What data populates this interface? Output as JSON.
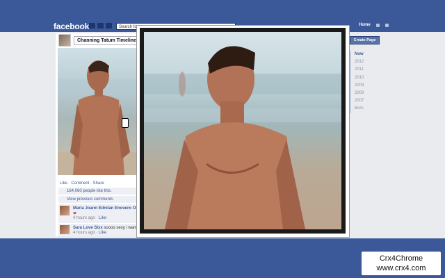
{
  "app": {
    "logo": "facebook"
  },
  "search": {
    "placeholder": "Search for"
  },
  "nav": {
    "home": "Home"
  },
  "profile": {
    "name": "Channing Tatum",
    "tab": "Timeline"
  },
  "post": {
    "actions": "Like · Comment · Share",
    "likes": "164,060 people like this.",
    "view_previous": "View previous comments",
    "comments": [
      {
        "name": "Maria Joann Ednilan Enovero",
        "text_suffix": "Om",
        "heart": "❤",
        "time": "4 hours ago",
        "like": "Like"
      },
      {
        "name": "Sara Love Sixx",
        "text": "soooo sexy i want",
        "time": "4 hours ago",
        "like": "Like"
      }
    ]
  },
  "sidebar": {
    "create_page": "Create Page",
    "years": [
      "Now",
      "2012",
      "2011",
      "2010",
      "2009",
      "2008",
      "2007",
      "Born"
    ]
  },
  "watermark": {
    "line1": "Crx4Chrome",
    "line2": "www.crx4.com"
  },
  "colors": {
    "brand": "#3b5998",
    "background": "#e9ebee"
  }
}
